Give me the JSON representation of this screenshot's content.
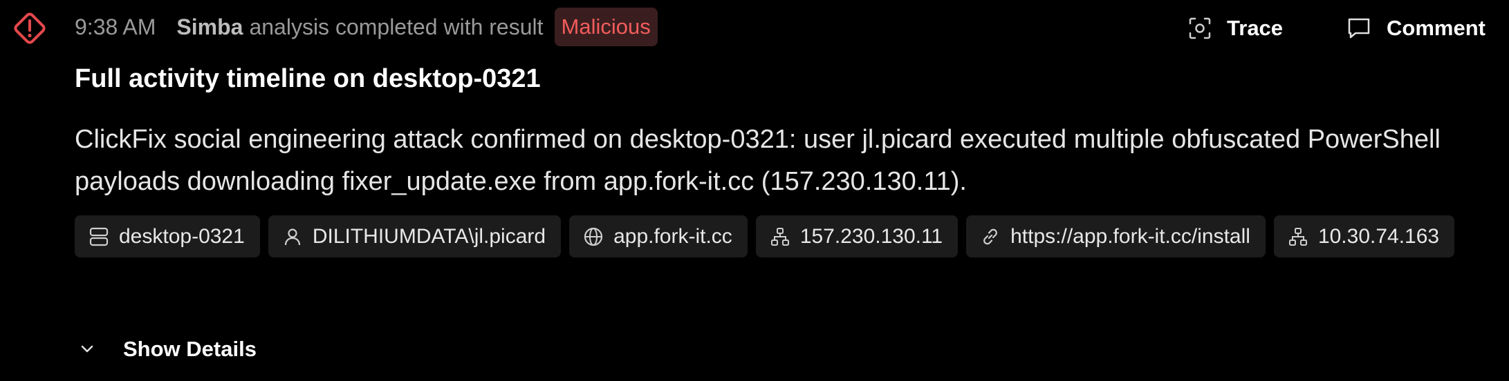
{
  "event": {
    "time": "9:38 AM",
    "agent": "Simba",
    "message": "analysis completed with result",
    "verdict": "Malicious"
  },
  "actions": {
    "trace_label": "Trace",
    "comment_label": "Comment"
  },
  "title": "Full activity timeline on desktop-0321",
  "description": "ClickFix social engineering attack confirmed on desktop-0321: user jl.picard executed multiple obfuscated PowerShell payloads downloading fixer_update.exe from app.fork-it.cc (157.230.130.11).",
  "entities": [
    {
      "icon": "server-icon",
      "label": "desktop-0321"
    },
    {
      "icon": "user-icon",
      "label": "DILITHIUMDATA\\jl.picard"
    },
    {
      "icon": "globe-icon",
      "label": "app.fork-it.cc"
    },
    {
      "icon": "network-icon",
      "label": "157.230.130.11"
    },
    {
      "icon": "link-icon",
      "label": "https://app.fork-it.cc/install"
    },
    {
      "icon": "network-icon",
      "label": "10.30.74.163"
    }
  ],
  "details": {
    "label": "Show Details"
  },
  "colors": {
    "background": "#000000",
    "alert": "#e5484d",
    "verdict_bg": "#3a1e1f",
    "verdict_text": "#f25c5c",
    "chip_bg": "#1c1c1c"
  }
}
